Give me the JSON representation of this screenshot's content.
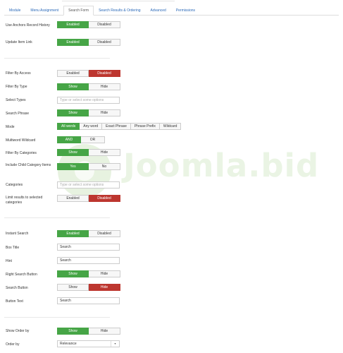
{
  "tabs": [
    "Module",
    "Menu Assignment",
    "Search Form",
    "Search Results & Ordering",
    "Advanced",
    "Permissions"
  ],
  "active_tab": 2,
  "watermark": {
    "text": "Joomla.bid"
  },
  "colors": {
    "green": "#46a546",
    "red": "#bd362f",
    "link": "#2a69b8"
  },
  "fields": {
    "anchors_history": {
      "label": "Use Anchors Record History",
      "options": [
        "Enabled",
        "Disabled"
      ],
      "selected": "Enabled"
    },
    "update_item_link": {
      "label": "Update Item Link",
      "options": [
        "Enabled",
        "Disabled"
      ],
      "selected": "Enabled"
    },
    "filter_access": {
      "label": "Filter By Access",
      "options": [
        "Enabled",
        "Disabled"
      ],
      "selected": "Disabled"
    },
    "filter_type": {
      "label": "Filter By Type",
      "options": [
        "Show",
        "Hide"
      ],
      "selected": "Show"
    },
    "select_types": {
      "label": "Select Types",
      "placeholder": "Type or select some options"
    },
    "search_phrase": {
      "label": "Search Phrase",
      "options": [
        "Show",
        "Hide"
      ],
      "selected": "Show"
    },
    "mode": {
      "label": "Mode",
      "options": [
        "All words",
        "Any word",
        "Exact Phrase",
        "Phrase Prefix",
        "Wildcard"
      ],
      "selected": "All words"
    },
    "multiword_wildcard": {
      "label": "Multiword Wildcard",
      "options": [
        "AND",
        "OR"
      ],
      "selected": "AND"
    },
    "filter_categories": {
      "label": "Filter By Categories",
      "options": [
        "Show",
        "Hide"
      ],
      "selected": "Show"
    },
    "child_categories": {
      "label": "Include Child Category Items",
      "options": [
        "Yes",
        "No"
      ],
      "selected": "Yes"
    },
    "categories": {
      "label": "Categories",
      "placeholder": "Type or select some options"
    },
    "limit_results": {
      "label": "Limit results to selected categories",
      "options": [
        "Enabled",
        "Disabled"
      ],
      "selected": "Disabled"
    },
    "instant_search": {
      "label": "Instant Search",
      "options": [
        "Enabled",
        "Disabled"
      ],
      "selected": "Enabled"
    },
    "box_title": {
      "label": "Box Title",
      "value": "Search"
    },
    "hint": {
      "label": "Hint",
      "value": "Search"
    },
    "right_search_button": {
      "label": "Right Search Button",
      "options": [
        "Show",
        "Hide"
      ],
      "selected": "Show"
    },
    "search_button": {
      "label": "Search Button",
      "options": [
        "Show",
        "Hide"
      ],
      "selected": "Hide"
    },
    "button_text": {
      "label": "Button Text",
      "value": "Search"
    },
    "show_order_by": {
      "label": "Show Order by",
      "options": [
        "Show",
        "Hide"
      ],
      "selected": "Show"
    },
    "order_by": {
      "label": "Order by",
      "value": "Relevance"
    }
  }
}
